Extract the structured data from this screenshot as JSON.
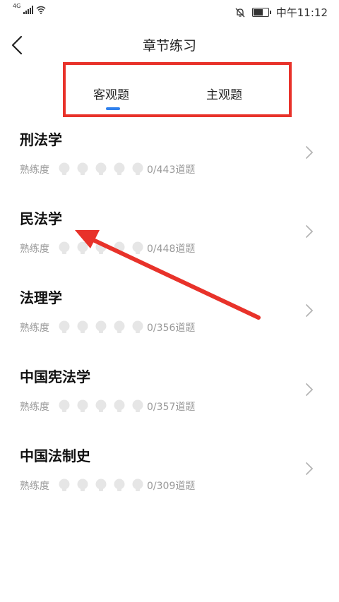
{
  "status_bar": {
    "network": "4G",
    "time": "中午11:12",
    "battery_level": 0.75
  },
  "nav": {
    "title": "章节练习"
  },
  "tabs": [
    {
      "label": "客观题",
      "active": true
    },
    {
      "label": "主观题",
      "active": false
    }
  ],
  "subjects": [
    {
      "name": "刑法学",
      "mastery_label": "熟练度",
      "progress": "0/443道题"
    },
    {
      "name": "民法学",
      "mastery_label": "熟练度",
      "progress": "0/448道题"
    },
    {
      "name": "法理学",
      "mastery_label": "熟练度",
      "progress": "0/356道题"
    },
    {
      "name": "中国宪法学",
      "mastery_label": "熟练度",
      "progress": "0/357道题"
    },
    {
      "name": "中国法制史",
      "mastery_label": "熟练度",
      "progress": "0/309道题"
    }
  ],
  "colors": {
    "annotation_red": "#e8322a",
    "tab_indicator": "#2f80ed",
    "muted_text": "#9a9a9a"
  },
  "icons": {
    "bulb": "lightbulb-icon",
    "chevron": "chevron-right-icon",
    "back": "chevron-left-icon"
  }
}
